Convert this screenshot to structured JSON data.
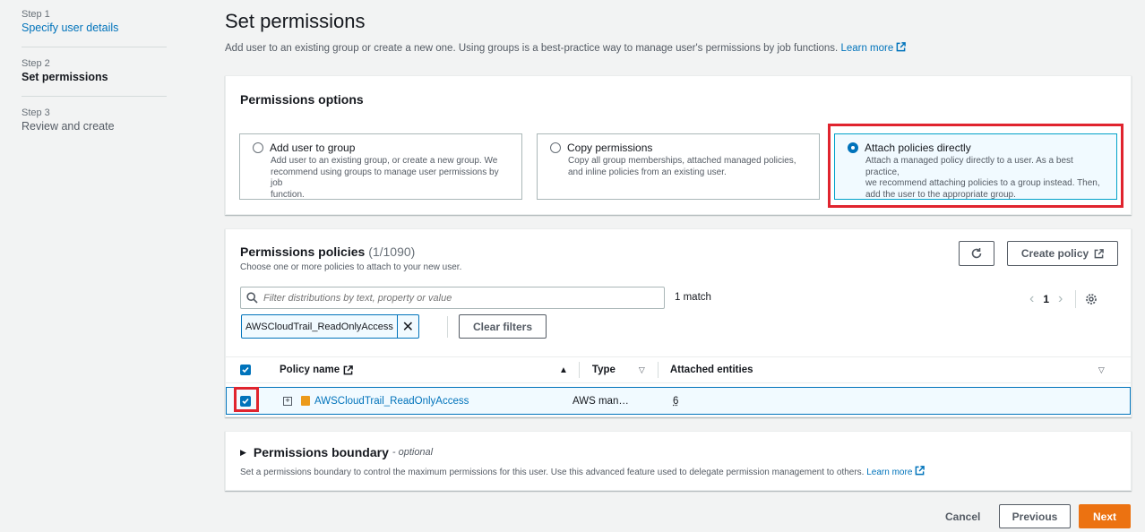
{
  "steps": [
    {
      "label": "Step 1",
      "name": "Specify user details"
    },
    {
      "label": "Step 2",
      "name": "Set permissions"
    },
    {
      "label": "Step 3",
      "name": "Review and create"
    }
  ],
  "page": {
    "title": "Set permissions",
    "description": "Add user to an existing group or create a new one. Using groups is a best-practice way to manage user's permissions by job functions.",
    "learn_more": "Learn more"
  },
  "options_panel": {
    "title": "Permissions options",
    "options": [
      {
        "title": "Add user to group",
        "desc": [
          "Add user to an existing group, or create a new group. We",
          "recommend using groups to manage user permissions by job",
          "function."
        ],
        "selected": false
      },
      {
        "title": "Copy permissions",
        "desc": [
          "Copy all group memberships, attached managed policies,",
          "and inline policies from an existing user."
        ],
        "selected": false
      },
      {
        "title": "Attach policies directly",
        "desc": [
          "Attach a managed policy directly to a user. As a best practice,",
          "we recommend attaching policies to a group instead. Then,",
          "add the user to the appropriate group."
        ],
        "selected": true
      }
    ]
  },
  "policies_panel": {
    "title": "Permissions policies",
    "count": "(1/1090)",
    "subtitle": "Choose one or more policies to attach to your new user.",
    "refresh_icon": "refresh-icon",
    "create_policy": "Create policy",
    "filter_placeholder": "Filter distributions by text, property or value",
    "match_count": "1 match",
    "page_number": "1",
    "filter_token": "AWSCloudTrail_ReadOnlyAccess",
    "clear_filters": "Clear filters",
    "columns": {
      "policy_name": "Policy name",
      "type": "Type",
      "attached": "Attached entities"
    },
    "rows": [
      {
        "name": "AWSCloudTrail_ReadOnlyAccess",
        "type": "AWS man…",
        "attached": "6",
        "checked": true
      }
    ]
  },
  "boundary_panel": {
    "title": "Permissions boundary",
    "optional": "- optional",
    "description": "Set a permissions boundary to control the maximum permissions for this user. Use this advanced feature used to delegate permission management to others.",
    "learn_more": "Learn more"
  },
  "footer": {
    "cancel": "Cancel",
    "previous": "Previous",
    "next": "Next"
  },
  "colors": {
    "accent": "#0073bb",
    "primary_button": "#ec7211",
    "highlight": "#e0242e"
  }
}
